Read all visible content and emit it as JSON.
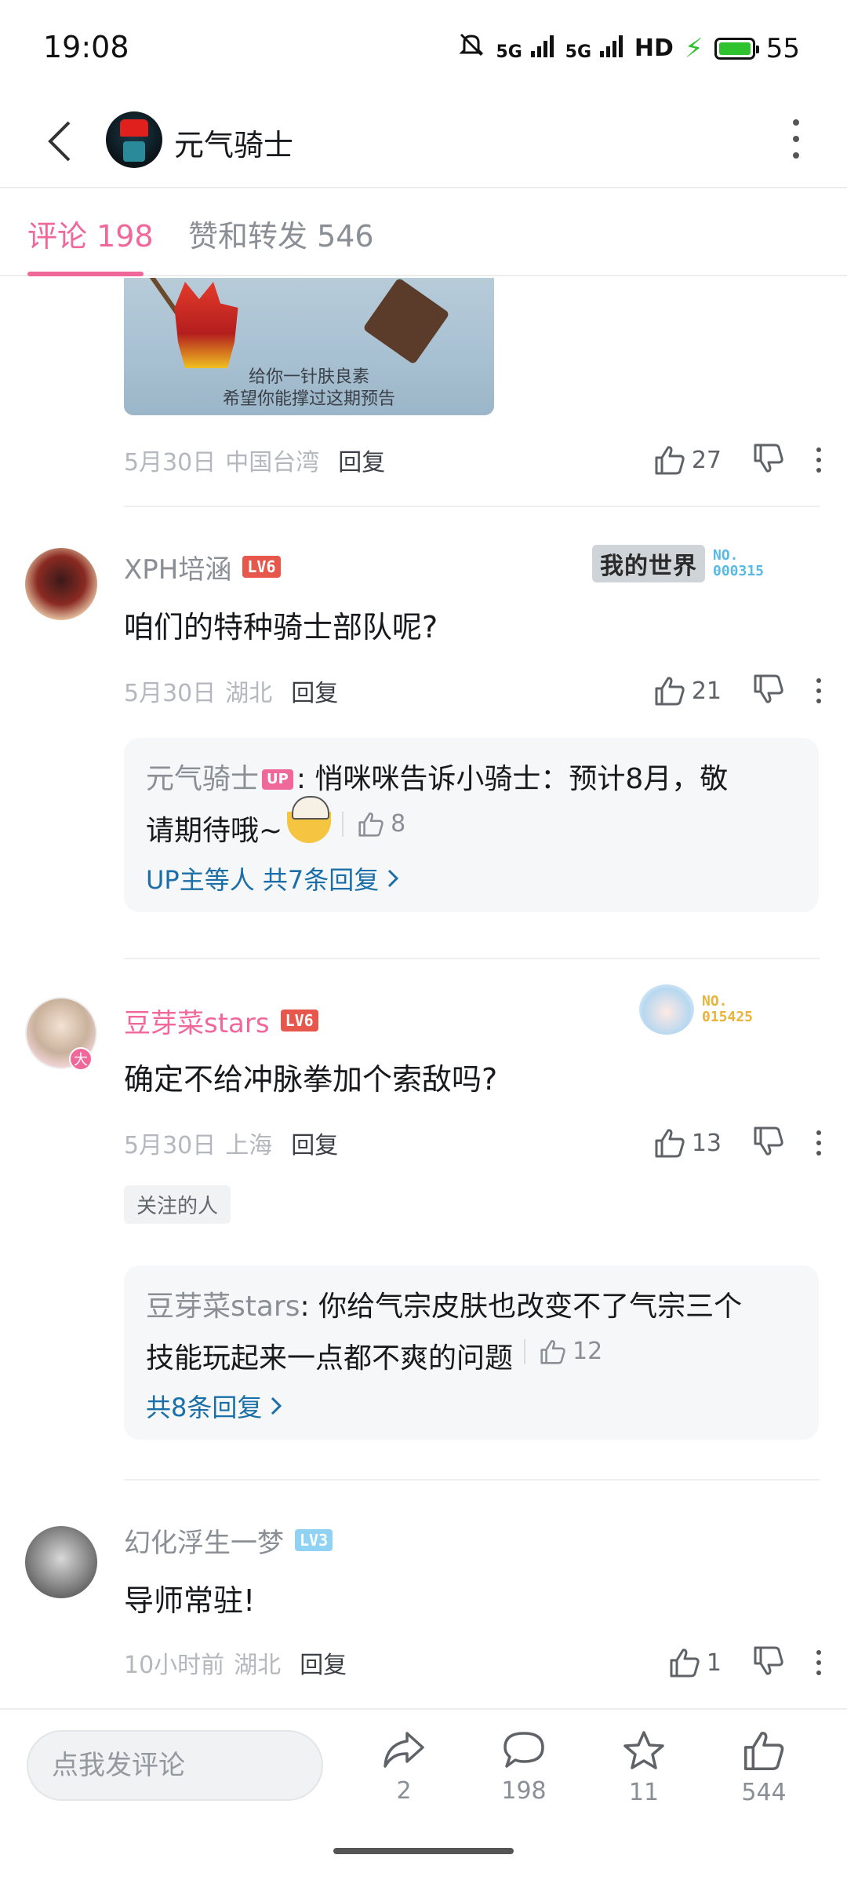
{
  "status_bar": {
    "time": "19:08",
    "signal1": "5G",
    "signal2": "5G",
    "hd": "HD",
    "battery": "55",
    "battery_color": "#2ec32e"
  },
  "header": {
    "title": "元气骑士"
  },
  "tabs": [
    {
      "label": "评论 198"
    },
    {
      "label": "赞和转发 546"
    }
  ],
  "accent_color": "#f0689a",
  "comments": [
    {
      "image_caption_line1": "给你一针肤良素",
      "image_caption_line2": "希望你能撑过这期预告",
      "date": "5月30日",
      "location": "中国台湾",
      "reply": "回复",
      "likes": "27"
    },
    {
      "username": "XPH培涵",
      "level": "LV6",
      "fan_logo": "我的世界",
      "fan_no_prefix": "NO.",
      "fan_no": "000315",
      "text": "咱们的特种骑士部队呢?",
      "date": "5月30日",
      "location": "湖北",
      "reply": "回复",
      "likes": "21",
      "sub_reply": {
        "name": "元气骑士",
        "tag": "UP",
        "text_part1": ": 悄咪咪告诉小骑士：预计8月，敬",
        "text_part2": "请期待哦~",
        "likes": "8",
        "more": "UP主等人 共7条回复"
      }
    },
    {
      "username": "豆芽菜stars",
      "level": "LV6",
      "avatar_badge": "大",
      "fan_no_prefix": "NO.",
      "fan_no": "015425",
      "text": "确定不给冲脉拳加个索敌吗?",
      "date": "5月30日",
      "location": "上海",
      "reply": "回复",
      "likes": "13",
      "follow_tag": "关注的人",
      "sub_reply": {
        "name": "豆芽菜stars",
        "text_part1": ": 你给气宗皮肤也改变不了气宗三个",
        "text_part2": "技能玩起来一点都不爽的问题",
        "likes": "12",
        "more": "共8条回复"
      }
    },
    {
      "username": "幻化浮生一梦",
      "level": "LV3",
      "text": "导师常驻!",
      "date": "10小时前",
      "location": "湖北",
      "reply": "回复",
      "likes": "1"
    }
  ],
  "bottom_bar": {
    "input_placeholder": "点我发评论",
    "share_count": "2",
    "comment_count": "198",
    "favorite_count": "11",
    "like_count": "544"
  }
}
